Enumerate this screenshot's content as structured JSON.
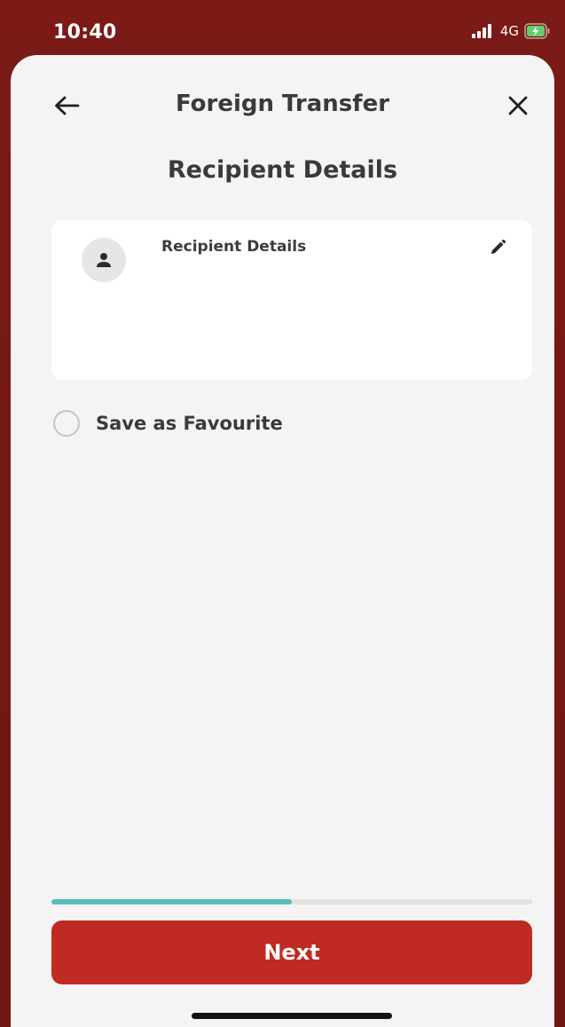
{
  "status_bar": {
    "time": "10:40",
    "network": "4G",
    "icons": [
      "signal-icon",
      "battery-charging-icon"
    ]
  },
  "header": {
    "title": "Foreign Transfer",
    "back_icon": "arrow-left-icon",
    "close_icon": "close-icon"
  },
  "section": {
    "title": "Recipient Details"
  },
  "recipient_card": {
    "label": "Recipient Details",
    "avatar_icon": "person-icon",
    "edit_icon": "pencil-icon"
  },
  "favourite": {
    "label": "Save as Favourite",
    "checked": false
  },
  "progress": {
    "fraction": 0.5
  },
  "footer": {
    "next_label": "Next"
  },
  "colors": {
    "status_bar_bg": "#7b1a17",
    "sheet_bg": "#f4f4f4",
    "accent_red": "#bf2a22",
    "progress_teal": "#55bfb8",
    "text_dark": "#3a3a3a"
  }
}
